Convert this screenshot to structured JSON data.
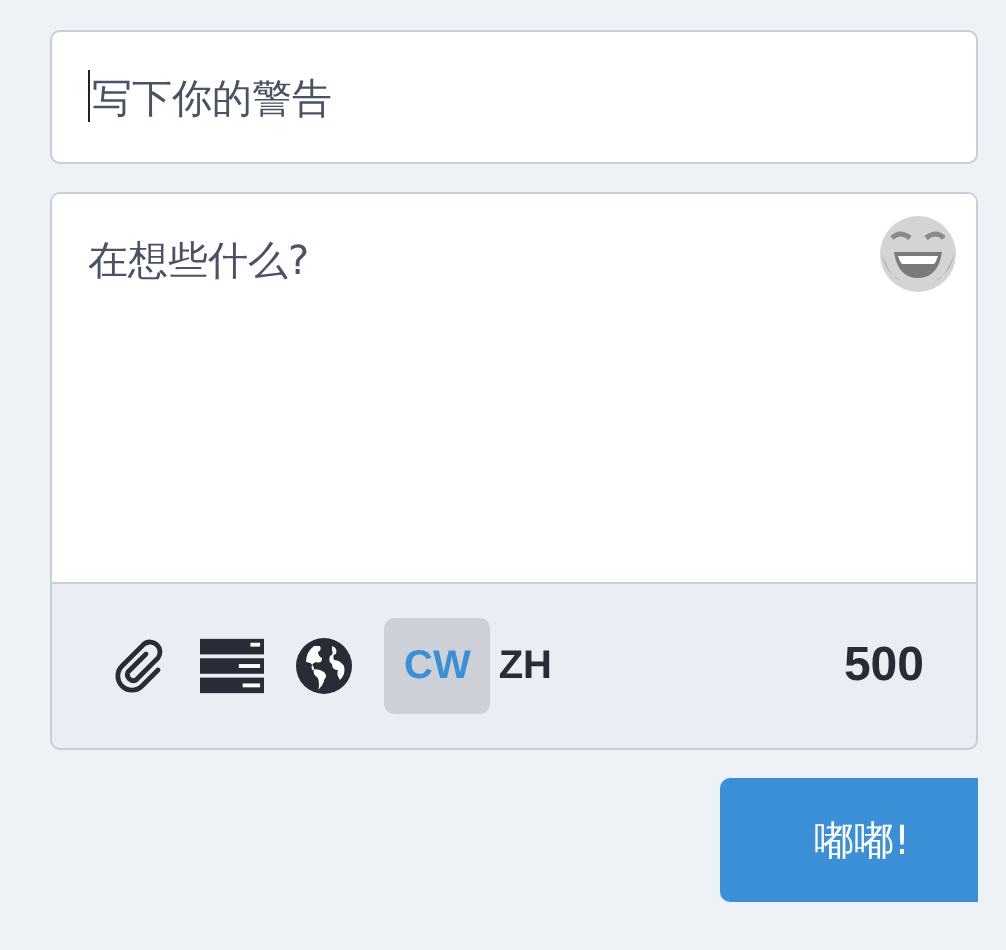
{
  "spoiler_field": {
    "placeholder": "写下你的警告",
    "focused": true
  },
  "compose_field": {
    "placeholder": "在想些什么?"
  },
  "toolbar": {
    "cw_button": {
      "label": "CW",
      "active": true
    },
    "language_button": {
      "label": "ZH"
    },
    "character_counter": "500"
  },
  "submit_button": {
    "label": "嘟嘟!"
  }
}
